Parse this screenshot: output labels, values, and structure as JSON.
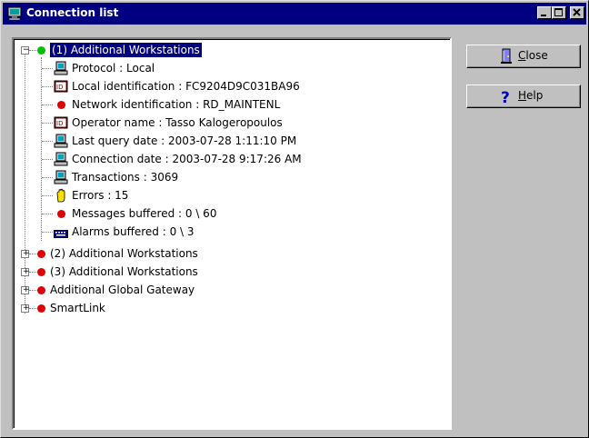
{
  "window": {
    "title": "Connection list"
  },
  "buttons": {
    "close_accel": "C",
    "close_rest": "lose",
    "help_accel": "H",
    "help_rest": "elp"
  },
  "tree": {
    "root": {
      "label": "(1) Additional Workstations",
      "status_color": "#00c000",
      "children": [
        {
          "label": "Protocol : Local",
          "icon": "computer-icon"
        },
        {
          "label": "Local identification : FC9204D9C031BA96",
          "icon": "id-card-icon"
        },
        {
          "label": "Network identification : RD_MAINTENL",
          "icon": "red-status-icon"
        },
        {
          "label": "Operator name : Tasso Kalogeropoulos",
          "icon": "id-card-icon"
        },
        {
          "label": "Last query date : 2003-07-28 1:11:10 PM",
          "icon": "computer-icon"
        },
        {
          "label": "Connection date : 2003-07-28 9:17:26 AM",
          "icon": "computer-icon"
        },
        {
          "label": "Transactions : 3069",
          "icon": "computer-icon"
        },
        {
          "label": "Errors : 15",
          "icon": "warning-hand-icon"
        },
        {
          "label": "Messages buffered : 0 \\ 60",
          "icon": "red-status-icon"
        },
        {
          "label": "Alarms buffered : 0 \\ 3",
          "icon": "keyboard-icon"
        }
      ]
    },
    "siblings": [
      {
        "label": "(2) Additional Workstations",
        "status_color": "#e00000"
      },
      {
        "label": "(3) Additional Workstations",
        "status_color": "#e00000"
      },
      {
        "label": "Additional Global Gateway",
        "status_color": "#e00000"
      },
      {
        "label": "SmartLink",
        "status_color": "#e00000"
      }
    ]
  },
  "colors": {
    "titlebar": "#000080",
    "selection": "#000080",
    "ok": "#00c000",
    "error": "#e00000"
  }
}
